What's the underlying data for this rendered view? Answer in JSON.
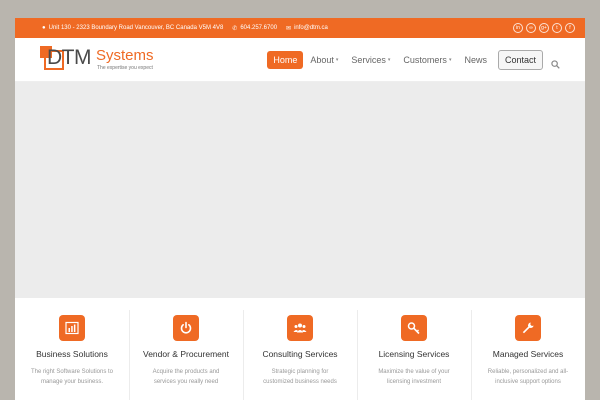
{
  "topbar": {
    "address": "Unit 130 - 2323 Boundary Road Vancouver, BC Canada V5M 4V8",
    "phone": "604.257.6700",
    "email": "info@dtm.ca",
    "social_icons": [
      "linkedin-icon",
      "rss-icon",
      "google-plus-icon",
      "twitter-icon",
      "facebook-icon"
    ],
    "social_glyphs": [
      "in",
      "∞",
      "g+",
      "t",
      "f"
    ],
    "color": "#ef6a24"
  },
  "logo": {
    "name": "DTM",
    "name_suffix": "Systems",
    "tagline": "The expertise you expect"
  },
  "nav": {
    "items": [
      {
        "label": "Home",
        "active": true
      },
      {
        "label": "About",
        "dropdown": true
      },
      {
        "label": "Services",
        "dropdown": true
      },
      {
        "label": "Customers",
        "dropdown": true
      },
      {
        "label": "News"
      },
      {
        "label": "Contact"
      }
    ]
  },
  "features": [
    {
      "icon": "bar-chart-icon",
      "title": "Business Solutions",
      "desc": "The right Software Solutions to manage your business."
    },
    {
      "icon": "power-icon",
      "title": "Vendor & Procurement",
      "desc": "Acquire the products and services you really need"
    },
    {
      "icon": "users-icon",
      "title": "Consulting Services",
      "desc": "Strategic planning for customized business needs"
    },
    {
      "icon": "key-icon",
      "title": "Licensing Services",
      "desc": "Maximize the value of your licensing investment"
    },
    {
      "icon": "wrench-icon",
      "title": "Managed Services",
      "desc": "Reliable, personalized and all-inclusive support options"
    }
  ]
}
